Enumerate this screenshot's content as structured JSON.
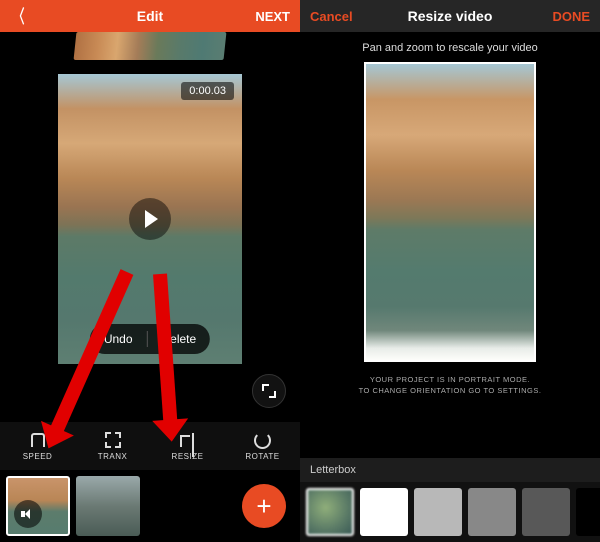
{
  "left": {
    "header": {
      "title": "Edit",
      "next": "NEXT"
    },
    "preview": {
      "timestamp": "0:00.03"
    },
    "actions": {
      "undo": "Undo",
      "delete": "Delete"
    },
    "tools": {
      "speed": "SPEED",
      "tranx": "TRANX",
      "resize": "RESIZE",
      "rotate": "ROTATE"
    }
  },
  "right": {
    "header": {
      "cancel": "Cancel",
      "title": "Resize video",
      "done": "DONE"
    },
    "subtitle": "Pan and zoom to rescale your video",
    "note_line1": "YOUR PROJECT IS IN PORTRAIT MODE.",
    "note_line2": "TO CHANGE ORIENTATION GO TO SETTINGS.",
    "letterbox_label": "Letterbox",
    "swatches": [
      "blur",
      "#ffffff",
      "#b8b8b8",
      "#888888",
      "#585858",
      "#000000"
    ]
  }
}
